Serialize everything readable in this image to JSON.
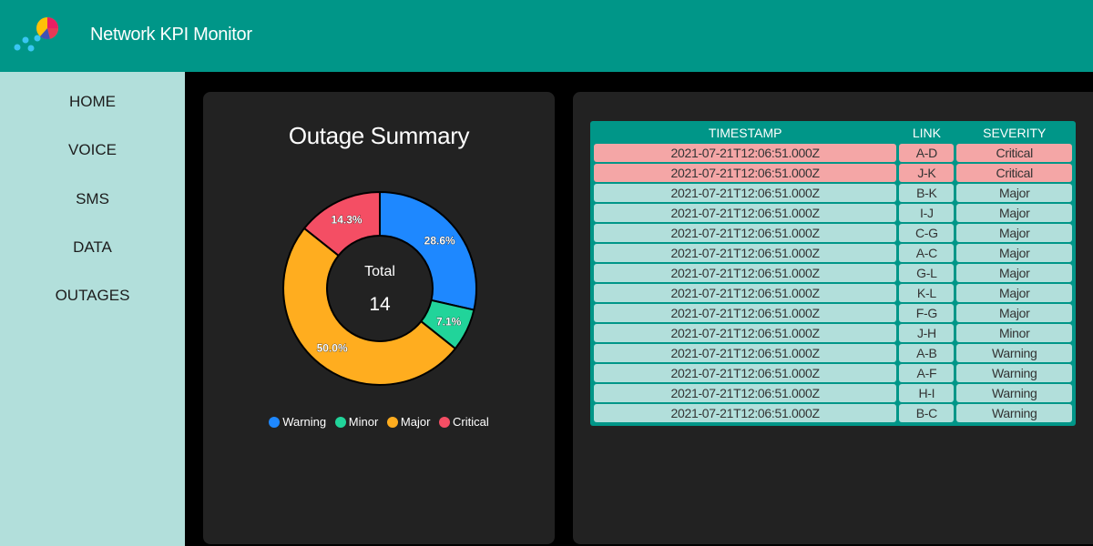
{
  "header": {
    "app_title": "Network KPI Monitor",
    "logo_icon": "pie-chart-dots-logo-icon"
  },
  "sidebar": {
    "items": [
      {
        "label": "HOME"
      },
      {
        "label": "VOICE"
      },
      {
        "label": "SMS"
      },
      {
        "label": "DATA"
      },
      {
        "label": "OUTAGES"
      }
    ]
  },
  "summary_panel": {
    "title": "Outage Summary",
    "center_label": "Total",
    "center_value": "14"
  },
  "chart_data": {
    "type": "pie",
    "title": "Outage Summary",
    "categories": [
      "Warning",
      "Minor",
      "Major",
      "Critical"
    ],
    "values": [
      4,
      1,
      7,
      2
    ],
    "percent_labels": [
      "28.6%",
      "7.1%",
      "50.0%",
      "14.3%"
    ],
    "colors": [
      "#1e88ff",
      "#21d49a",
      "#ffad1f",
      "#f44e64"
    ],
    "donut": true,
    "legend_position": "bottom"
  },
  "table": {
    "columns": [
      "TIMESTAMP",
      "LINK",
      "SEVERITY"
    ],
    "rows": [
      {
        "timestamp": "2021-07-21T12:06:51.000Z",
        "link": "A-D",
        "severity": "Critical"
      },
      {
        "timestamp": "2021-07-21T12:06:51.000Z",
        "link": "J-K",
        "severity": "Critical"
      },
      {
        "timestamp": "2021-07-21T12:06:51.000Z",
        "link": "B-K",
        "severity": "Major"
      },
      {
        "timestamp": "2021-07-21T12:06:51.000Z",
        "link": "I-J",
        "severity": "Major"
      },
      {
        "timestamp": "2021-07-21T12:06:51.000Z",
        "link": "C-G",
        "severity": "Major"
      },
      {
        "timestamp": "2021-07-21T12:06:51.000Z",
        "link": "A-C",
        "severity": "Major"
      },
      {
        "timestamp": "2021-07-21T12:06:51.000Z",
        "link": "G-L",
        "severity": "Major"
      },
      {
        "timestamp": "2021-07-21T12:06:51.000Z",
        "link": "K-L",
        "severity": "Major"
      },
      {
        "timestamp": "2021-07-21T12:06:51.000Z",
        "link": "F-G",
        "severity": "Major"
      },
      {
        "timestamp": "2021-07-21T12:06:51.000Z",
        "link": "J-H",
        "severity": "Minor"
      },
      {
        "timestamp": "2021-07-21T12:06:51.000Z",
        "link": "A-B",
        "severity": "Warning"
      },
      {
        "timestamp": "2021-07-21T12:06:51.000Z",
        "link": "A-F",
        "severity": "Warning"
      },
      {
        "timestamp": "2021-07-21T12:06:51.000Z",
        "link": "H-I",
        "severity": "Warning"
      },
      {
        "timestamp": "2021-07-21T12:06:51.000Z",
        "link": "B-C",
        "severity": "Warning"
      }
    ]
  },
  "colors": {
    "header": "#009688",
    "sidebar": "#b2dfdb",
    "panel": "#222222",
    "critical_row": "#f4a6a6",
    "normal_row": "#b2dfdb"
  }
}
